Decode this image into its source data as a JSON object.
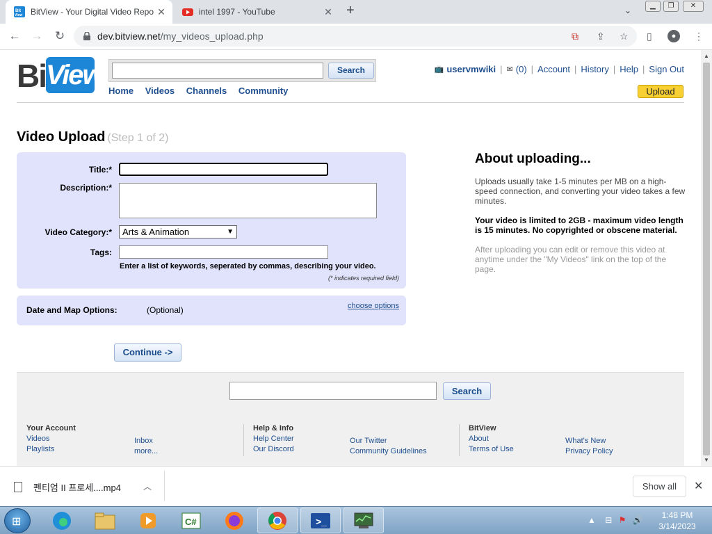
{
  "browser": {
    "tabs": [
      {
        "title": "BitView - Your Digital Video Repo",
        "favicon": "bitview-icon",
        "active": true
      },
      {
        "title": "intel 1997 - YouTube",
        "favicon": "youtube-icon",
        "active": false
      }
    ],
    "url_host": "dev.bitview.net",
    "url_path": "/my_videos_upload.php"
  },
  "site": {
    "logo_bit": "Bit",
    "logo_view": "View",
    "search_button": "Search",
    "nav": [
      "Home",
      "Videos",
      "Channels",
      "Community"
    ],
    "user": {
      "username": "uservmwiki",
      "inbox_count": "(0)",
      "account": "Account",
      "history": "History",
      "help": "Help",
      "signout": "Sign Out",
      "upload": "Upload"
    }
  },
  "upload": {
    "heading": "Video Upload",
    "step": "(Step 1 of 2)",
    "title_label": "Title:*",
    "title_value": "",
    "description_label": "Description:*",
    "category_label": "Video Category:*",
    "category_value": "Arts & Animation",
    "tags_label": "Tags:",
    "tags_hint": "Enter a list of keywords, seperated by commas, describing your video.",
    "required_note": "(* indicates required field)",
    "date_map_label": "Date and Map Options:",
    "optional": "(Optional)",
    "choose_options": "choose options",
    "continue": "Continue ->"
  },
  "about": {
    "heading": "About uploading...",
    "p1": "Uploads usually take 1-5 minutes per MB on a high-speed connection, and converting your video takes a few minutes.",
    "p2": "Your video is limited to 2GB - maximum video length is 15 minutes. No copyrighted or obscene material.",
    "p3": "After uploading you can edit or remove this video at anytime under the \"My Videos\" link on the top of the page."
  },
  "footer": {
    "search_button": "Search",
    "your_account": {
      "heading": "Your Account",
      "links": [
        "Videos",
        "Playlists",
        "Inbox",
        "more..."
      ]
    },
    "help_info": {
      "heading": "Help & Info",
      "links": [
        "Help Center",
        "Our Discord",
        "Our Twitter",
        "Community Guidelines"
      ]
    },
    "bitview": {
      "heading": "BitView",
      "links": [
        "About",
        "Terms of Use",
        "What's New",
        "Privacy Policy"
      ]
    }
  },
  "download": {
    "filename": "펜티엄 II 프로세....mp4",
    "show_all": "Show all"
  },
  "taskbar": {
    "time": "1:48 PM",
    "date": "3/14/2023"
  }
}
